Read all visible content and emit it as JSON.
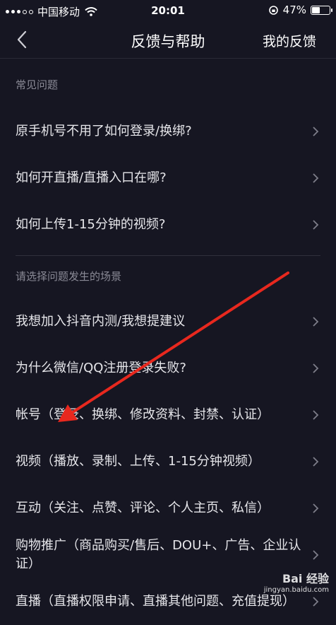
{
  "status_bar": {
    "carrier": "中国移动",
    "time": "20:01",
    "battery": "47%",
    "battery_level": 0.47
  },
  "nav": {
    "title": "反馈与帮助",
    "right_action": "我的反馈"
  },
  "sections": [
    {
      "header": "常见问题",
      "items": [
        "原手机号不用了如何登录/换绑?",
        "如何开直播/直播入口在哪?",
        "如何上传1-15分钟的视频?"
      ]
    },
    {
      "header": "请选择问题发生的场景",
      "items": [
        "我想加入抖音内测/我想提建议",
        "为什么微信/QQ注册登录失败?",
        "帐号（登录、换绑、修改资料、封禁、认证）",
        "视频（播放、录制、上传、1-15分钟视频）",
        "互动（关注、点赞、评论、个人主页、私信）",
        "购物推广（商品购买/售后、DOU+、广告、企业认证）",
        "直播（直播权限申请、直播其他问题、充值提现）"
      ]
    }
  ],
  "watermark": {
    "main": "Bai 经验",
    "sub": "jingyan.baidu.com"
  },
  "annotation": {
    "color": "#e8281e"
  }
}
